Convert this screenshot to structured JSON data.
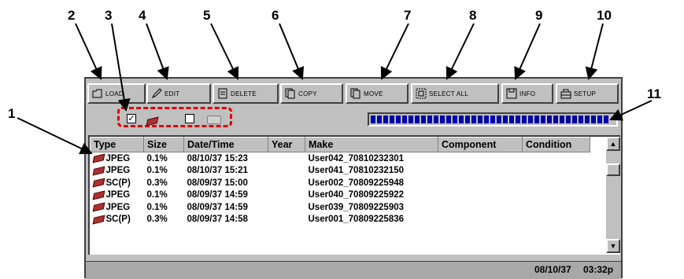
{
  "callouts": [
    "1",
    "2",
    "3",
    "4",
    "5",
    "6",
    "7",
    "8",
    "9",
    "10",
    "11"
  ],
  "toolbar": {
    "load": "LOAD",
    "edit": "EDIT",
    "delete": "DELETE",
    "copy": "COPY",
    "move": "MOVE",
    "select_all": "SELECT ALL",
    "info": "INFO",
    "setup": "SETUP"
  },
  "filters": {
    "checked_mark": "✓"
  },
  "table": {
    "headers": [
      "Type",
      "Size",
      "Date/Time",
      "Year",
      "Make",
      "Component",
      "Condition"
    ],
    "rows": [
      [
        "JPEG",
        "0.1%",
        "08/10/37 15:23",
        "",
        "User042_70810232301",
        "",
        ""
      ],
      [
        "JPEG",
        "0.1%",
        "08/10/37 15:21",
        "",
        "User041_70810232150",
        "",
        ""
      ],
      [
        "SC(P)",
        "0.3%",
        "08/09/37 15:00",
        "",
        "User002_70809225948",
        "",
        ""
      ],
      [
        "JPEG",
        "0.1%",
        "08/09/37 14:59",
        "",
        "User040_70809225922",
        "",
        ""
      ],
      [
        "JPEG",
        "0.1%",
        "08/09/37 14:59",
        "",
        "User039_70809225903",
        "",
        ""
      ],
      [
        "SC(P)",
        "0.3%",
        "08/09/37 14:58",
        "",
        "User001_70809225836",
        "",
        ""
      ]
    ]
  },
  "status": {
    "date": "08/10/37",
    "time": "03:32p"
  },
  "colors": {
    "accent_red": "#e00000",
    "progress_blue": "#0000a8",
    "panel_gray": "#c0c0c0"
  }
}
